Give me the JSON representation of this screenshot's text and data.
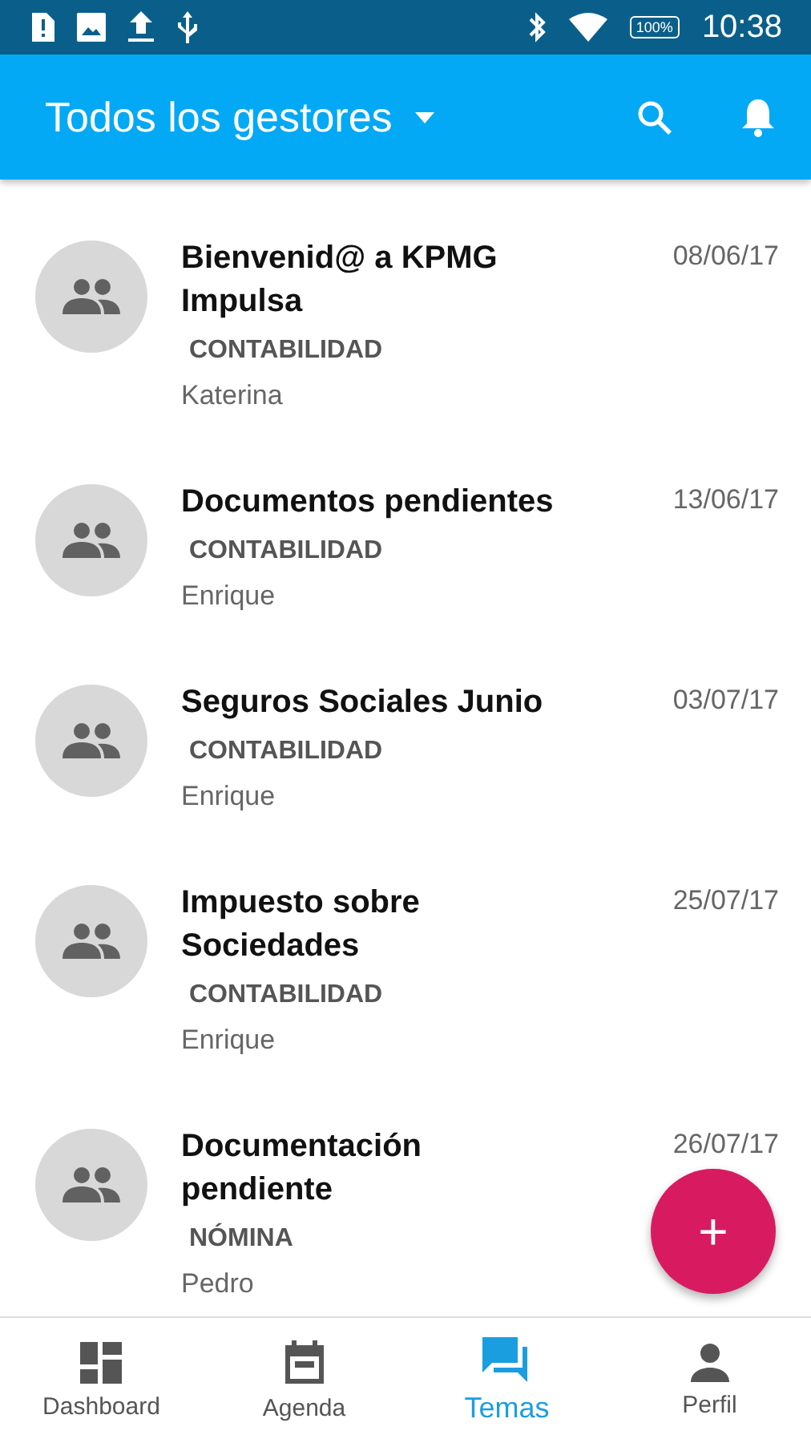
{
  "status_bar": {
    "battery": "100%",
    "time": "10:38"
  },
  "app_bar": {
    "title": "Todos los gestores"
  },
  "topics": [
    {
      "title": "Bienvenid@ a KPMG Impulsa",
      "category": "CONTABILIDAD",
      "author": "Katerina",
      "date": "08/06/17"
    },
    {
      "title": "Documentos pendientes",
      "category": "CONTABILIDAD",
      "author": "Enrique",
      "date": "13/06/17"
    },
    {
      "title": "Seguros Sociales Junio",
      "category": "CONTABILIDAD",
      "author": "Enrique",
      "date": "03/07/17"
    },
    {
      "title": "Impuesto sobre Sociedades",
      "category": "CONTABILIDAD",
      "author": "Enrique",
      "date": "25/07/17"
    },
    {
      "title": "Documentación pendiente",
      "category": "NÓMINA",
      "author": "Pedro",
      "date": "26/07/17"
    }
  ],
  "fab": {
    "label": "+"
  },
  "bottom_nav": [
    {
      "label": "Dashboard",
      "kind": "dashboard",
      "selected": false
    },
    {
      "label": "Agenda",
      "kind": "agenda",
      "selected": false
    },
    {
      "label": "Temas",
      "kind": "temas",
      "selected": true
    },
    {
      "label": "Perfil",
      "kind": "perfil",
      "selected": false
    }
  ]
}
